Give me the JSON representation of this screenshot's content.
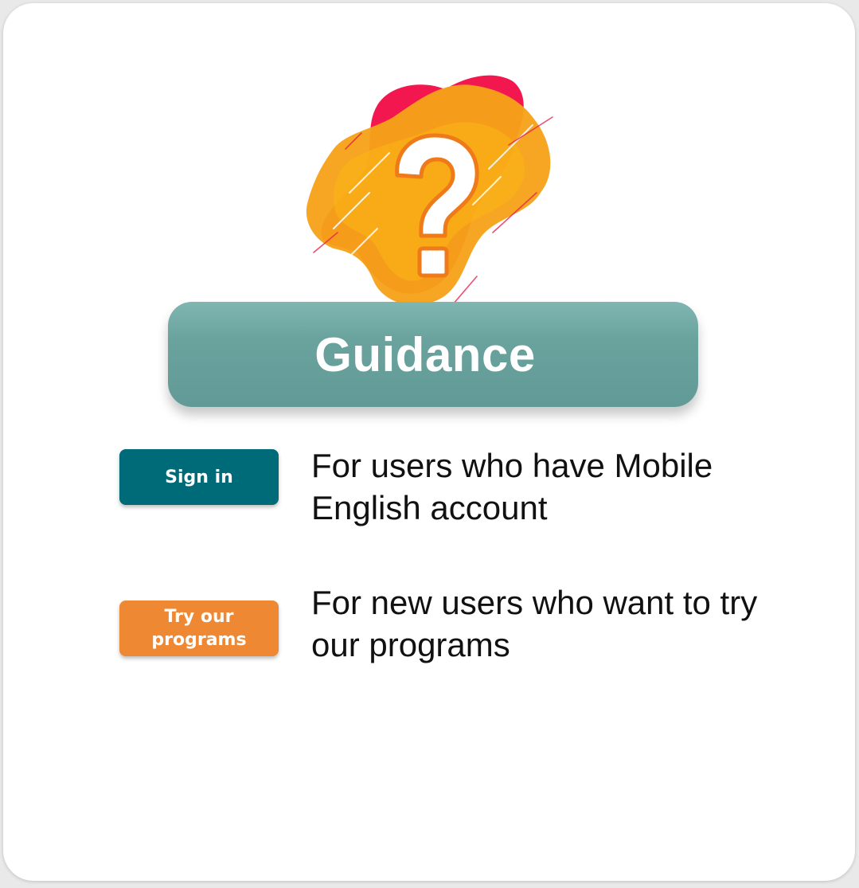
{
  "illustration": {
    "icon": "question-mark-icon",
    "colors": {
      "blob_back": "#f2174f",
      "blob_front": "#f6a21a",
      "mark": "#ffffff",
      "mark_outline": "#ef7a1a"
    }
  },
  "banner": {
    "title": "Guidance",
    "color": "#629b97"
  },
  "options": [
    {
      "button_label": "Sign in",
      "button_color": "#006b78",
      "description": "For users who have Mobile English account"
    },
    {
      "button_label": "Try our programs",
      "button_color": "#ef8832",
      "description": "For new users who want to try our programs"
    }
  ]
}
